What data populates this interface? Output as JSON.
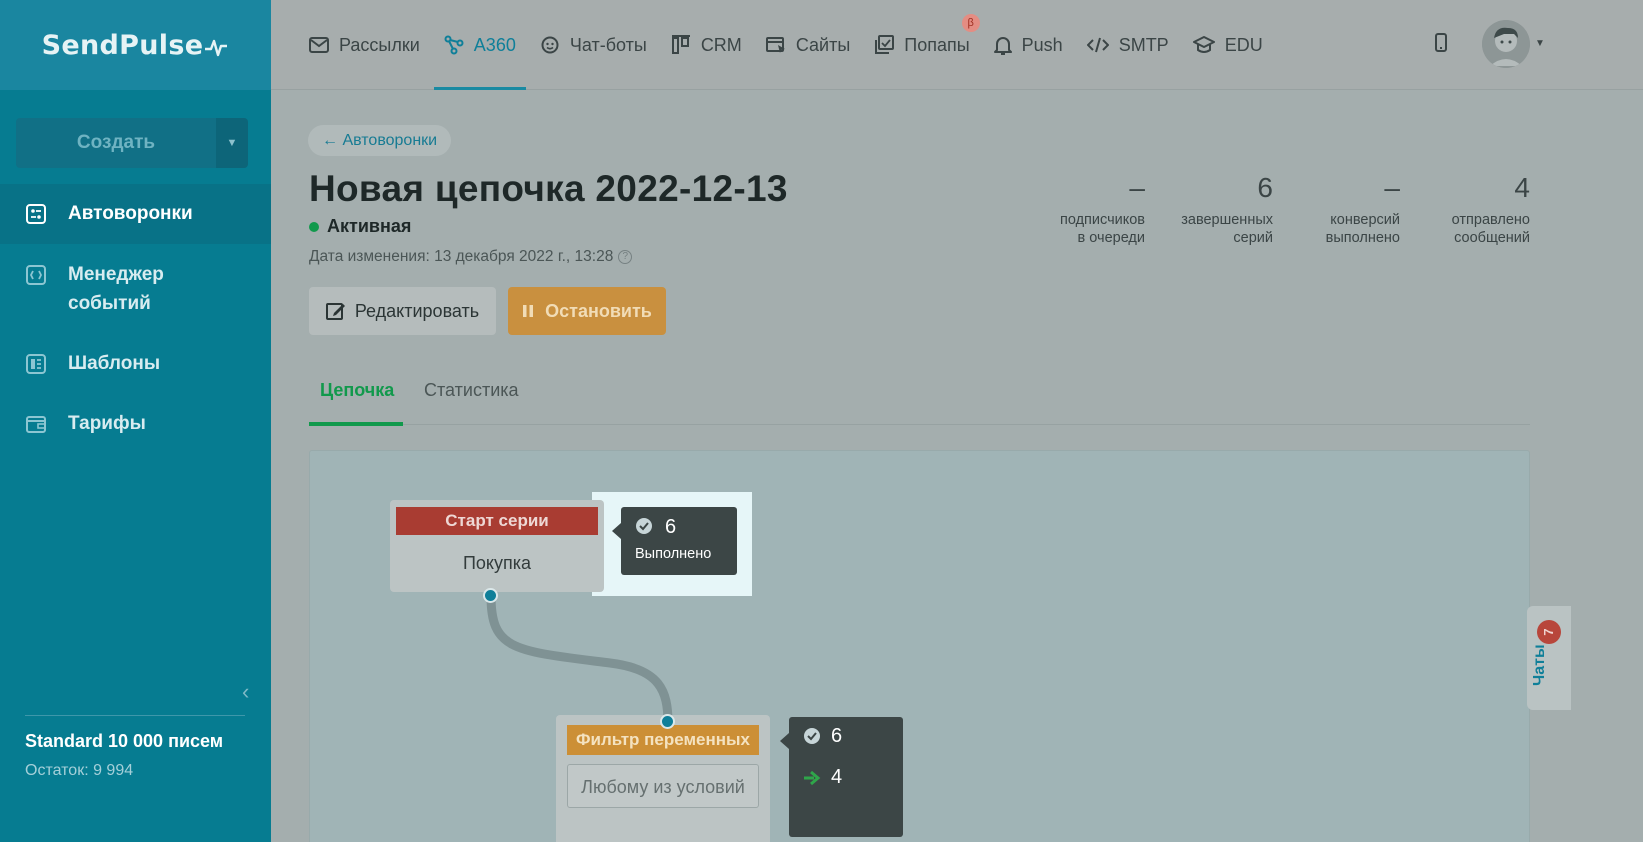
{
  "brand": {
    "name": "SendPulse",
    "pulse": "⁄∿"
  },
  "sidebar": {
    "create_label": "Создать",
    "items": [
      {
        "label": "Автоворонки",
        "icon": "funnel-icon",
        "active": true
      },
      {
        "label": "Менеджер событий",
        "icon": "event-manager-icon",
        "active": false
      },
      {
        "label": "Шаблоны",
        "icon": "templates-icon",
        "active": false
      },
      {
        "label": "Тарифы",
        "icon": "wallet-icon",
        "active": false
      }
    ],
    "plan": {
      "name": "Standard 10 000 писем",
      "remaining": "Остаток: 9 994"
    }
  },
  "topnav": {
    "items": [
      {
        "label": "Рассылки",
        "icon": "mail-icon",
        "active": false
      },
      {
        "label": "A360",
        "icon": "automation-icon",
        "active": true
      },
      {
        "label": "Чат-боты",
        "icon": "chatbot-icon",
        "active": false
      },
      {
        "label": "CRM",
        "icon": "crm-icon",
        "active": false
      },
      {
        "label": "Сайты",
        "icon": "sites-icon",
        "active": false
      },
      {
        "label": "Попапы",
        "icon": "popups-icon",
        "active": false,
        "badge": "β"
      },
      {
        "label": "Push",
        "icon": "bell-icon",
        "active": false
      },
      {
        "label": "SMTP",
        "icon": "code-icon",
        "active": false
      },
      {
        "label": "EDU",
        "icon": "edu-icon",
        "active": false
      }
    ]
  },
  "page": {
    "back_link": "← Автоворонки",
    "title": "Новая цепочка 2022-12-13",
    "status": "Активная",
    "modified": "Дата изменения: 13 декабря 2022 г., 13:28",
    "edit_label": "Редактировать",
    "stop_label": "Остановить",
    "stats": [
      {
        "value": "–",
        "label1": "подписчиков",
        "label2": "в очереди"
      },
      {
        "value": "6",
        "label1": "завершенных",
        "label2": "серий"
      },
      {
        "value": "–",
        "label1": "конверсий",
        "label2": "выполнено"
      },
      {
        "value": "4",
        "label1": "отправлено",
        "label2": "сообщений"
      }
    ],
    "tabs": [
      {
        "label": "Цепочка",
        "active": true
      },
      {
        "label": "Статистика",
        "active": false
      }
    ]
  },
  "flow": {
    "start_node": {
      "header": "Старт серии",
      "body": "Покупка"
    },
    "start_tooltip": {
      "count": "6",
      "label": "Выполнено"
    },
    "filter_node": {
      "header": "Фильтр переменных",
      "body": "Любому из условий"
    },
    "filter_tooltip": {
      "count_done": "6",
      "count_next": "4"
    }
  },
  "chats": {
    "label": "Чаты",
    "badge": "7"
  },
  "colors": {
    "accent": "#0f7f99",
    "success": "#11994c",
    "warning": "#cc8f36",
    "danger": "#a93c32"
  }
}
